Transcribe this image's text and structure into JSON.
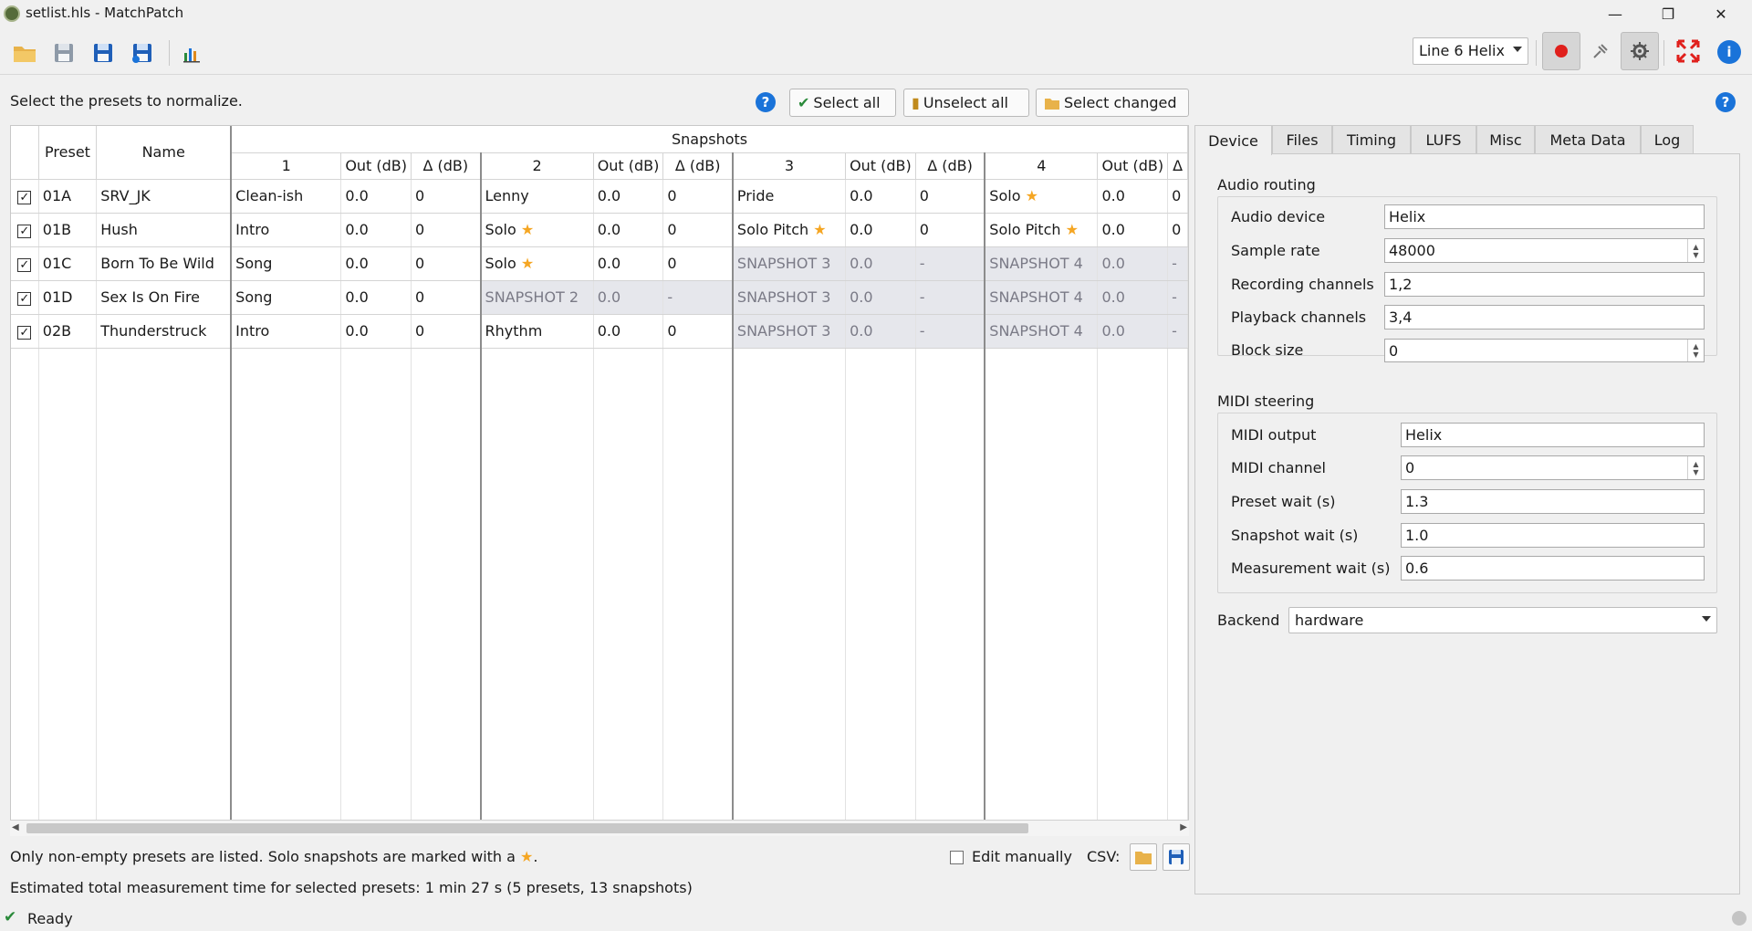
{
  "window": {
    "title": "setlist.hls - MatchPatch"
  },
  "toolbar": {
    "device_select": "Line 6 Helix"
  },
  "instructions": "Select the presets to normalize.",
  "actions": {
    "select_all": "Select all",
    "unselect_all": "Unselect all",
    "select_changed": "Select changed",
    "help": "?"
  },
  "table": {
    "group_header": "Snapshots",
    "headers": {
      "preset": "Preset",
      "name": "Name",
      "s1": "1",
      "s2": "2",
      "s3": "3",
      "s4": "4",
      "out": "Out (dB)",
      "delta": "Δ (dB)",
      "delta_partial": "Δ"
    },
    "rows": [
      {
        "preset": "01A",
        "name": "SRV_JK",
        "s1": {
          "name": "Clean-ish",
          "out": "0.0",
          "d": "0"
        },
        "s2": {
          "name": "Lenny",
          "out": "0.0",
          "d": "0"
        },
        "s3": {
          "name": "Pride",
          "out": "0.0",
          "d": "0"
        },
        "s4": {
          "name": "Solo",
          "out": "0.0",
          "d": "0"
        }
      },
      {
        "preset": "01B",
        "name": "Hush",
        "s1": {
          "name": "Intro",
          "out": "0.0",
          "d": "0"
        },
        "s2": {
          "name": "Solo",
          "out": "0.0",
          "d": "0"
        },
        "s3": {
          "name": "Solo Pitch",
          "out": "0.0",
          "d": "0"
        },
        "s4": {
          "name": "Solo Pitch",
          "out": "0.0",
          "d": "0"
        }
      },
      {
        "preset": "01C",
        "name": "Born To Be Wild",
        "s1": {
          "name": "Song",
          "out": "0.0",
          "d": "0"
        },
        "s2": {
          "name": "Solo",
          "out": "0.0",
          "d": "0"
        },
        "s3": {
          "name": "SNAPSHOT 3",
          "out": "0.0",
          "d": "-"
        },
        "s4": {
          "name": "SNAPSHOT 4",
          "out": "0.0",
          "d": "-"
        }
      },
      {
        "preset": "01D",
        "name": "Sex Is On Fire",
        "s1": {
          "name": "Song",
          "out": "0.0",
          "d": "0"
        },
        "s2": {
          "name": "SNAPSHOT 2",
          "out": "0.0",
          "d": "-"
        },
        "s3": {
          "name": "SNAPSHOT 3",
          "out": "0.0",
          "d": "-"
        },
        "s4": {
          "name": "SNAPSHOT 4",
          "out": "0.0",
          "d": "-"
        }
      },
      {
        "preset": "02B",
        "name": "Thunderstruck",
        "s1": {
          "name": "Intro",
          "out": "0.0",
          "d": "0"
        },
        "s2": {
          "name": "Rhythm",
          "out": "0.0",
          "d": "0"
        },
        "s3": {
          "name": "SNAPSHOT 3",
          "out": "0.0",
          "d": "-"
        },
        "s4": {
          "name": "SNAPSHOT 4",
          "out": "0.0",
          "d": "-"
        }
      }
    ],
    "d_partial_values": [
      "0",
      "0",
      "-",
      "-",
      "-"
    ],
    "star": "★"
  },
  "tabs": [
    "Device",
    "Files",
    "Timing",
    "LUFS",
    "Misc",
    "Meta Data",
    "Log"
  ],
  "device": {
    "audio_routing_title": "Audio routing",
    "audio_device_label": "Audio device",
    "audio_device": "Helix",
    "sample_rate_label": "Sample rate",
    "sample_rate": "48000",
    "recording_channels_label": "Recording channels",
    "recording_channels": "1,2",
    "playback_channels_label": "Playback channels",
    "playback_channels": "3,4",
    "block_size_label": "Block size",
    "block_size": "0",
    "midi_title": "MIDI steering",
    "midi_output_label": "MIDI output",
    "midi_output": "Helix",
    "midi_channel_label": "MIDI channel",
    "midi_channel": "0",
    "preset_wait_label": "Preset wait (s)",
    "preset_wait": "1.3",
    "snapshot_wait_label": "Snapshot wait (s)",
    "snapshot_wait": "1.0",
    "measurement_wait_label": "Measurement wait (s)",
    "measurement_wait": "0.6",
    "backend_label": "Backend",
    "backend": "hardware"
  },
  "footer": {
    "note_prefix": "Only non-empty presets are listed. Solo snapshots are marked with a",
    "note_suffix": ".",
    "edit_manually": "Edit manually",
    "csv_label": "CSV:",
    "estimate": "Estimated total measurement time for selected presets: 1 min 27 s (5 presets, 13 snapshots)",
    "status": "Ready"
  },
  "colors": {
    "accent": "#1a73d9",
    "record": "#e0201c",
    "star": "#f5a623",
    "disabled_cell": "#e6e7ec"
  }
}
